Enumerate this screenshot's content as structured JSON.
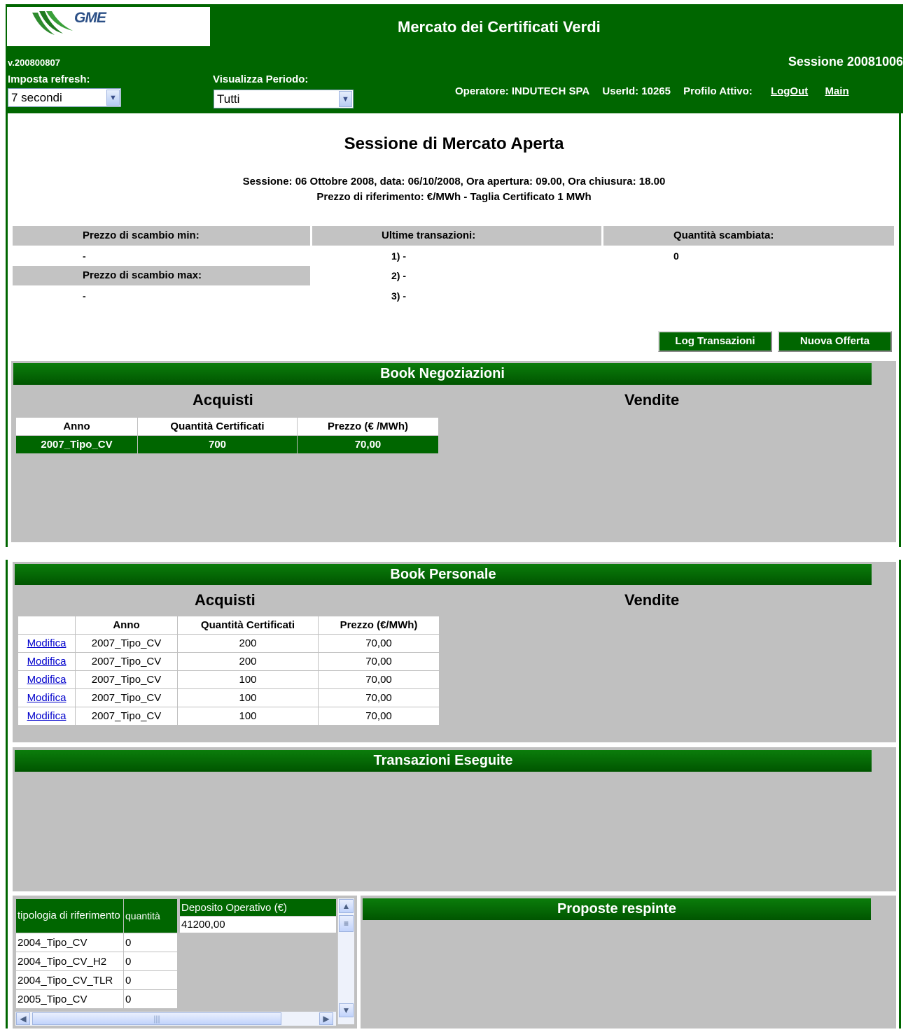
{
  "header": {
    "logo_text": "GME",
    "app_title": "Mercato dei Certificati Verdi",
    "version": "v.200800807",
    "session_code": "Sessione 20081006",
    "refresh_label": "Imposta refresh:",
    "refresh_value": "7 secondi",
    "periodo_label": "Visualizza Periodo:",
    "periodo_value": "Tutti",
    "operatore": "Operatore: INDUTECH SPA",
    "userid": "UserId: 10265",
    "profilo": "Profilo Attivo:",
    "logout": "LogOut",
    "main": "Main",
    "brand_color": "#006600"
  },
  "session": {
    "title": "Sessione di Mercato Aperta",
    "line1": "Sessione: 06 Ottobre 2008, data: 06/10/2008, Ora apertura: 09.00, Ora chiusura: 18.00",
    "line2": "Prezzo di riferimento: €/MWh - Taglia Certificato 1 MWh"
  },
  "stats": {
    "min_label": "Prezzo di scambio min:",
    "min_value": "-",
    "max_label": "Prezzo di scambio max:",
    "max_value": "-",
    "ultime_label": "Ultime transazioni:",
    "ultime": [
      "1) -",
      "2) -",
      "3) -"
    ],
    "quantita_label": "Quantità scambiata:",
    "quantita_value": "0"
  },
  "buttons": {
    "log_transazioni": "Log Transazioni",
    "nuova_offerta": "Nuova Offerta"
  },
  "book_negoziazioni": {
    "title": "Book Negoziazioni",
    "acquisti": "Acquisti",
    "vendite": "Vendite",
    "headers": [
      "Anno",
      "Quantità Certificati",
      "Prezzo (€ /MWh)"
    ],
    "rows": [
      [
        "2007_Tipo_CV",
        "700",
        "70,00"
      ]
    ]
  },
  "book_personale": {
    "title": "Book Personale",
    "acquisti": "Acquisti",
    "vendite": "Vendite",
    "headers": [
      "",
      "Anno",
      "Quantità Certificati",
      "Prezzo (€/MWh)"
    ],
    "rows": [
      {
        "link": "Modifica",
        "anno": "2007_Tipo_CV",
        "qty": "200",
        "prezzo": "70,00"
      },
      {
        "link": "Modifica",
        "anno": "2007_Tipo_CV",
        "qty": "200",
        "prezzo": "70,00"
      },
      {
        "link": "Modifica",
        "anno": "2007_Tipo_CV",
        "qty": "100",
        "prezzo": "70,00"
      },
      {
        "link": "Modifica",
        "anno": "2007_Tipo_CV",
        "qty": "100",
        "prezzo": "70,00"
      },
      {
        "link": "Modifica",
        "anno": "2007_Tipo_CV",
        "qty": "100",
        "prezzo": "70,00"
      }
    ]
  },
  "transazioni": {
    "title": "Transazioni Eseguite"
  },
  "deposito": {
    "col1": "tipologia di riferimento",
    "col2": "quantità",
    "col3": "Deposito Operativo (€)",
    "deposito_value": "41200,00",
    "rows": [
      [
        "2004_Tipo_CV",
        "0"
      ],
      [
        "2004_Tipo_CV_H2",
        "0"
      ],
      [
        "2004_Tipo_CV_TLR",
        "0"
      ],
      [
        "2005_Tipo_CV",
        "0"
      ]
    ]
  },
  "proposte": {
    "title": "Proposte respinte"
  }
}
